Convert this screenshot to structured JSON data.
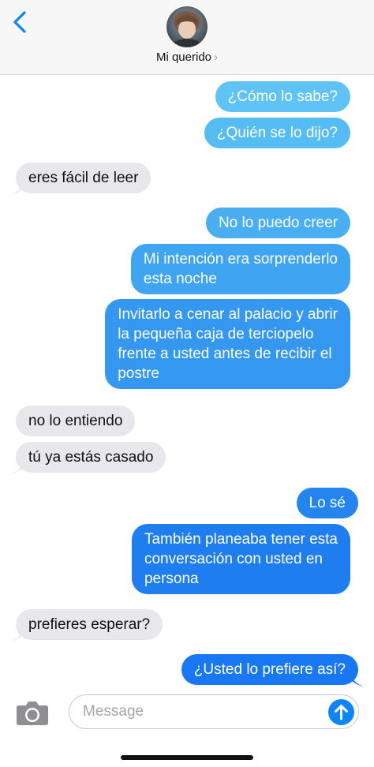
{
  "header": {
    "contact_name": "Mi querido",
    "chevron": "›",
    "back_icon": "chevron-left-icon",
    "avatar": "contact-avatar-photo"
  },
  "messages": [
    {
      "from": "me",
      "text": "¿Cómo lo sabe?"
    },
    {
      "from": "me",
      "text": "¿Quién se lo dijo?"
    },
    {
      "from": "them",
      "text": "eres fácil de leer"
    },
    {
      "from": "me",
      "text": "No lo puedo creer"
    },
    {
      "from": "me",
      "lines": [
        "Mi intención era sorprenderlo",
        "esta noche"
      ]
    },
    {
      "from": "me",
      "lines": [
        "Invitarlo a cenar al palacio y abrir",
        "la pequeña caja de terciopelo",
        "frente a usted antes de recibir el",
        "postre"
      ]
    },
    {
      "from": "them",
      "text": "no lo entiendo"
    },
    {
      "from": "them",
      "text": "tú ya estás casado"
    },
    {
      "from": "me",
      "text": "Lo sé"
    },
    {
      "from": "me",
      "lines": [
        "También planeaba tener esta",
        "conversación con usted en",
        "persona"
      ]
    },
    {
      "from": "them",
      "text": "prefieres esperar?"
    },
    {
      "from": "me",
      "text": "¿Usted lo prefiere así?"
    }
  ],
  "composer": {
    "placeholder": "Message",
    "camera_icon": "camera-icon",
    "send_icon": "arrow-up-icon"
  },
  "colors": {
    "outgoing_top": "#5ac3f5",
    "outgoing_bottom": "#1877f2",
    "incoming": "#e8e8ec",
    "send_button": "#0b84fe"
  }
}
